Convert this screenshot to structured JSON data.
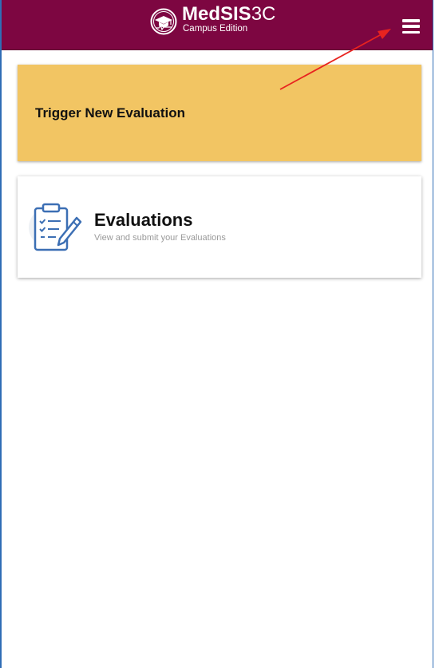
{
  "header": {
    "brand_bold": "MedSIS",
    "brand_light": "3C",
    "brand_sub": "Campus Edition",
    "menu_icon": "hamburger-menu-icon",
    "background_color": "#7d0641"
  },
  "annotation": {
    "arrow_color": "#e8231f"
  },
  "cards": {
    "trigger": {
      "label": "Trigger New Evaluation",
      "background_color": "#f2c563"
    },
    "evaluations": {
      "title": "Evaluations",
      "subtitle": "View and submit your Evaluations",
      "icon": "clipboard-checklist-icon"
    }
  }
}
